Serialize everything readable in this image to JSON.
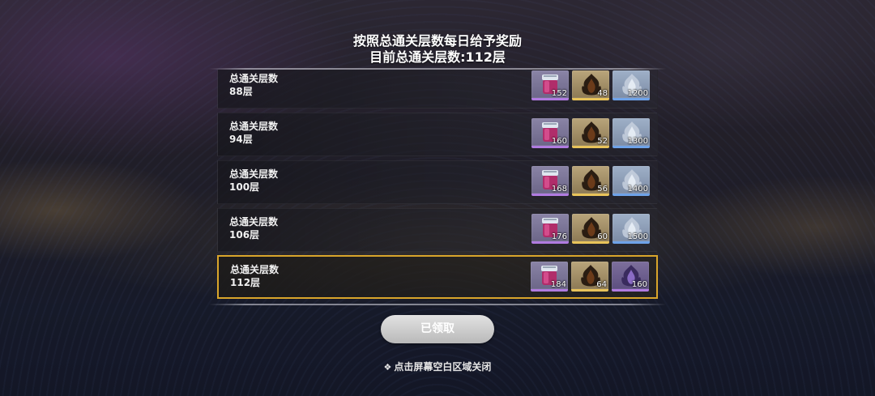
{
  "header": {
    "line1": "按照总通关层数每日给予奖励",
    "line2": "目前总通关层数:112层"
  },
  "rows": [
    {
      "title": "总通关层数",
      "floors": "88层",
      "items": [
        {
          "icon": "potion-jar-icon",
          "qty": "152",
          "rarity": "purple"
        },
        {
          "icon": "dark-flame-icon",
          "qty": "48",
          "rarity": "gold"
        },
        {
          "icon": "silver-flame-icon",
          "qty": "1200",
          "rarity": "blue"
        }
      ]
    },
    {
      "title": "总通关层数",
      "floors": "94层",
      "items": [
        {
          "icon": "potion-jar-icon",
          "qty": "160",
          "rarity": "purple"
        },
        {
          "icon": "dark-flame-icon",
          "qty": "52",
          "rarity": "gold"
        },
        {
          "icon": "silver-flame-icon",
          "qty": "1300",
          "rarity": "blue"
        }
      ]
    },
    {
      "title": "总通关层数",
      "floors": "100层",
      "items": [
        {
          "icon": "potion-jar-icon",
          "qty": "168",
          "rarity": "purple"
        },
        {
          "icon": "dark-flame-icon",
          "qty": "56",
          "rarity": "gold"
        },
        {
          "icon": "silver-flame-icon",
          "qty": "1400",
          "rarity": "blue"
        }
      ]
    },
    {
      "title": "总通关层数",
      "floors": "106层",
      "items": [
        {
          "icon": "potion-jar-icon",
          "qty": "176",
          "rarity": "purple"
        },
        {
          "icon": "dark-flame-icon",
          "qty": "60",
          "rarity": "gold"
        },
        {
          "icon": "silver-flame-icon",
          "qty": "1500",
          "rarity": "blue"
        }
      ]
    },
    {
      "title": "总通关层数",
      "floors": "112层",
      "current": true,
      "items": [
        {
          "icon": "potion-jar-icon",
          "qty": "184",
          "rarity": "purple"
        },
        {
          "icon": "dark-flame-icon",
          "qty": "64",
          "rarity": "gold"
        },
        {
          "icon": "purple-flame-icon",
          "qty": "160",
          "rarity": "purple2"
        }
      ]
    }
  ],
  "claim_button": {
    "label": "已领取",
    "state": "claimed"
  },
  "close_hint": {
    "icon": "❖",
    "text": "点击屏幕空白区域关闭"
  },
  "colors": {
    "highlight_border": "#d9a52b",
    "rarity_purple": "#b07be0",
    "rarity_gold": "#e8c35a",
    "rarity_blue": "#6ea2e8"
  }
}
